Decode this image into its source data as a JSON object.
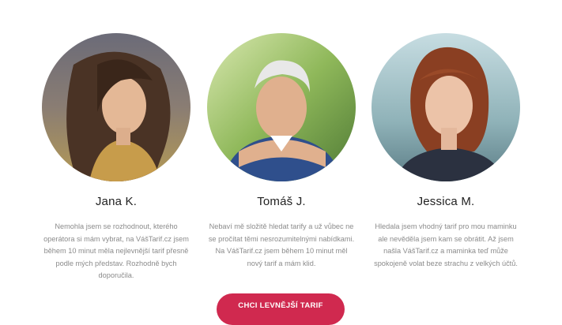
{
  "testimonials": [
    {
      "name": "Jana K.",
      "photo_icon": "woman-portrait-photo",
      "quote": "Nemohla jsem se rozhodnout, kterého operátora si mám vybrat, na VášTarif.cz jsem během 10 minut měla nejlevnější tarif přesně podle mých představ. Rozhodně bych doporučila."
    },
    {
      "name": "Tomáš J.",
      "photo_icon": "older-man-portrait-photo",
      "quote": "Nebaví mě složitě hledat tarify a už vůbec ne se pročítat těmi nesrozumitelnými nabídkami. Na VášTarif.cz jsem během 10 minut měl nový tarif a mám klid."
    },
    {
      "name": "Jessica M.",
      "photo_icon": "young-woman-portrait-photo",
      "quote": "Hledala jsem vhodný tarif pro mou maminku ale nevěděla jsem kam se obrátit. Až jsem našla VášTarif.cz a maminka teď může spokojeně volat beze strachu z velkých účtů."
    }
  ],
  "cta": {
    "label": "CHCI LEVNĚJŠÍ TARIF"
  },
  "colors": {
    "accent": "#d0294f",
    "text": "#222222",
    "muted": "#8b8b8b"
  }
}
